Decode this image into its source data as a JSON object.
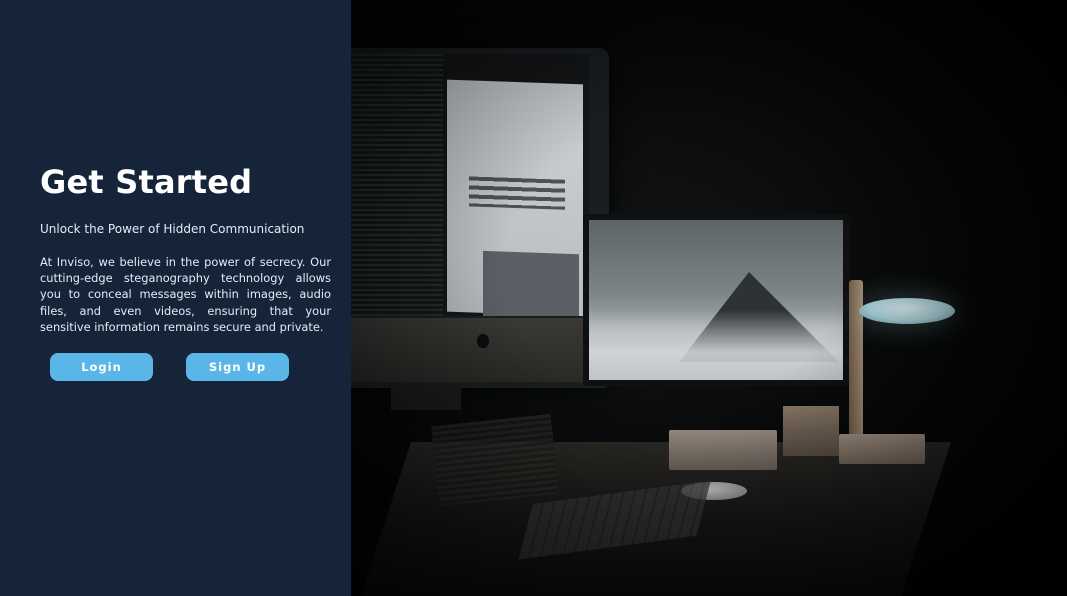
{
  "hero": {
    "title": "Get Started",
    "subtitle": "Unlock the Power of Hidden Communication",
    "description": "At Inviso, we believe in the power of secrecy. Our cutting-edge steganography technology allows you to conceal messages within images, audio files, and even videos, ensuring that your sensitive information remains secure and private."
  },
  "actions": {
    "login_label": "Login",
    "signup_label": "Sign Up"
  },
  "colors": {
    "panel_background": "#16243a",
    "button_background": "#5ab6e8",
    "text_primary": "#ffffff"
  },
  "image": {
    "alt_icon": "workspace-photo"
  }
}
